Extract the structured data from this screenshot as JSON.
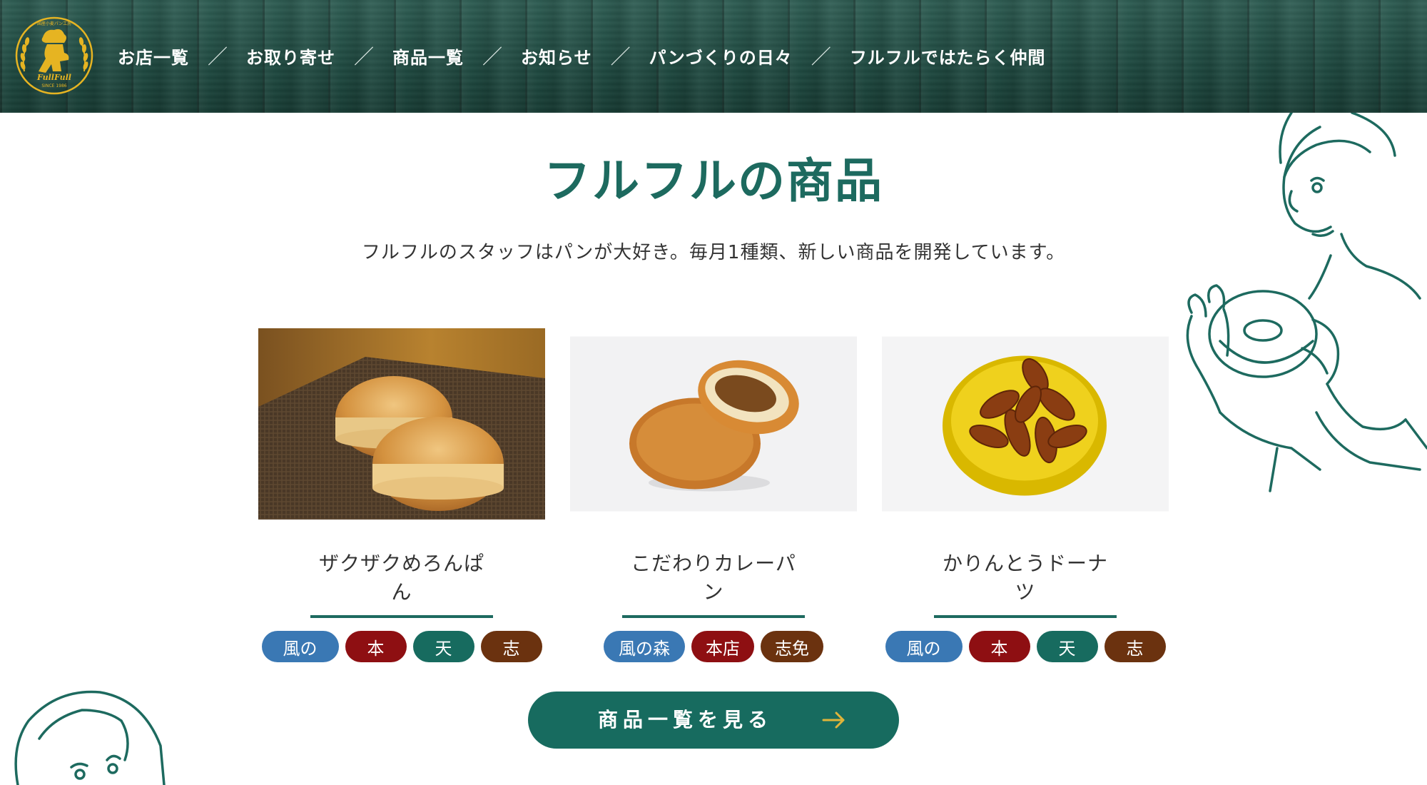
{
  "logo": {
    "top_text": "国産小麦パン工房",
    "brand_text": "FullFull",
    "since_text": "SINCE 1986"
  },
  "nav": {
    "items": [
      "お店一覧",
      "お取り寄せ",
      "商品一覧",
      "お知らせ",
      "パンづくりの日々",
      "フルフルではたらく仲間"
    ],
    "separator": "／"
  },
  "main": {
    "title": "フルフルの商品",
    "lead": "フルフルのスタッフはパンが大好き。毎月1種類、新しい商品を開発しています。"
  },
  "products": [
    {
      "name": "ザクザクめろんぱん",
      "image": "melon-pan-photo",
      "tags": [
        {
          "label": "風の",
          "color": "#3a78b4"
        },
        {
          "label": "本",
          "color": "#8e0f12"
        },
        {
          "label": "天",
          "color": "#176b5f"
        },
        {
          "label": "志",
          "color": "#6b320f"
        }
      ]
    },
    {
      "name": "こだわりカレーパン",
      "image": "curry-pan-photo",
      "tags": [
        {
          "label": "風の森",
          "color": "#3a78b4"
        },
        {
          "label": "本店",
          "color": "#8e0f12"
        },
        {
          "label": "志免",
          "color": "#6b320f"
        }
      ]
    },
    {
      "name": "かりんとうドーナツ",
      "image": "karinto-donut-photo",
      "tags": [
        {
          "label": "風の",
          "color": "#3a78b4"
        },
        {
          "label": "本",
          "color": "#8e0f12"
        },
        {
          "label": "天",
          "color": "#176b5f"
        },
        {
          "label": "志",
          "color": "#6b320f"
        }
      ]
    }
  ],
  "more_button": {
    "label": "商品一覧を見る",
    "arrow_color": "#e0b43a",
    "icon": "arrow-right-icon"
  },
  "colors": {
    "brand_green": "#1d6a5f",
    "header_green": "#244f46",
    "logo_gold": "#e6b422"
  }
}
